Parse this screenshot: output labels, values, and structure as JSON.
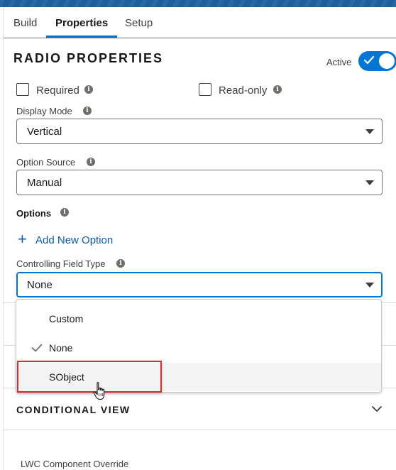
{
  "tabs": [
    {
      "label": "Build"
    },
    {
      "label": "Properties"
    },
    {
      "label": "Setup"
    }
  ],
  "properties": {
    "title": "RADIO PROPERTIES",
    "active_label": "Active",
    "active_on": true,
    "required_label": "Required",
    "readonly_label": "Read-only"
  },
  "fields": {
    "display_mode": {
      "label": "Display Mode",
      "value": "Vertical"
    },
    "option_source": {
      "label": "Option Source",
      "value": "Manual"
    },
    "options_label": "Options",
    "add_option_label": "Add New Option",
    "controlling_field_type": {
      "label": "Controlling Field Type",
      "value": "None"
    }
  },
  "dropdown": {
    "options": [
      {
        "label": "Custom",
        "selected": false
      },
      {
        "label": "None",
        "selected": true
      },
      {
        "label": "SObject",
        "selected": false
      }
    ]
  },
  "sections": {
    "conditional_view": "CONDITIONAL VIEW",
    "lwc_override": "LWC Component Override"
  },
  "colors": {
    "accent": "#0176d3",
    "highlight": "#d62d2d"
  }
}
